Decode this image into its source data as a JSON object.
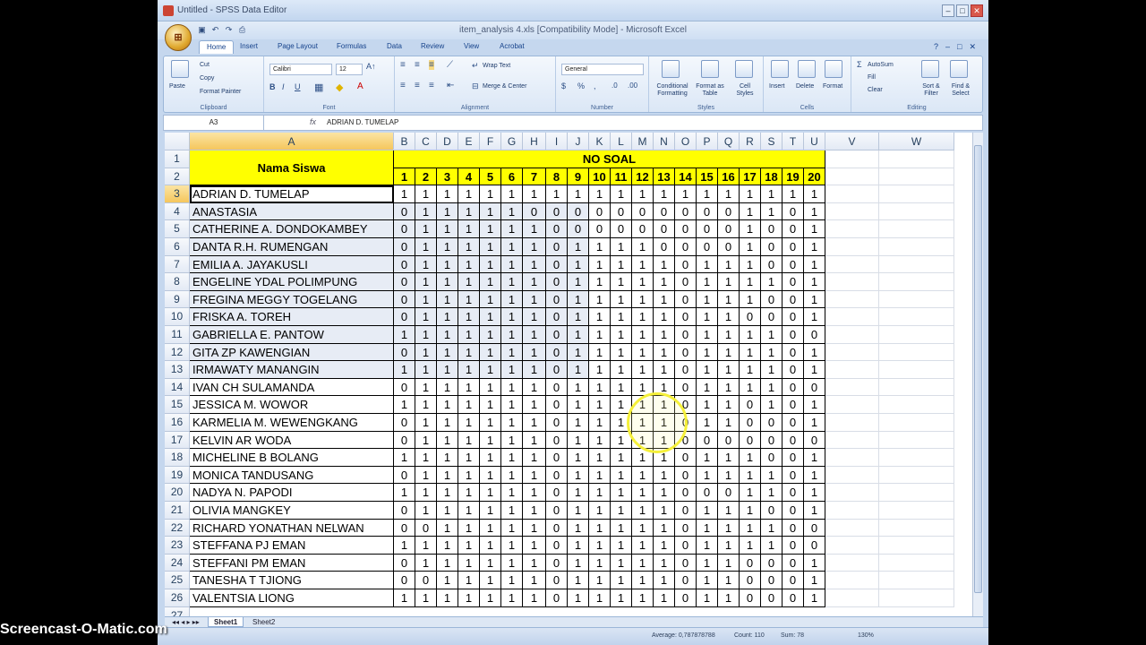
{
  "spss_title": "Untitled - SPSS Data Editor",
  "excel_title": "item_analysis 4.xls  [Compatibility Mode] - Microsoft Excel",
  "tabs": [
    "Home",
    "Insert",
    "Page Layout",
    "Formulas",
    "Data",
    "Review",
    "View",
    "Acrobat"
  ],
  "ribbon": {
    "clipboard": {
      "paste": "Paste",
      "cut": "Cut",
      "copy": "Copy",
      "format_painter": "Format Painter",
      "label": "Clipboard"
    },
    "font": {
      "name": "Calibri",
      "size": "12",
      "label": "Font"
    },
    "alignment": {
      "wrap": "Wrap Text",
      "merge": "Merge & Center",
      "label": "Alignment"
    },
    "number": {
      "format": "General",
      "label": "Number"
    },
    "styles": {
      "conditional": "Conditional Formatting",
      "format_table": "Format as Table",
      "cell_styles": "Cell Styles",
      "label": "Styles"
    },
    "cells": {
      "insert": "Insert",
      "delete": "Delete",
      "format": "Format",
      "label": "Cells"
    },
    "editing": {
      "autosum": "AutoSum",
      "fill": "Fill",
      "clear": "Clear",
      "sort": "Sort & Filter",
      "find": "Find & Select",
      "label": "Editing"
    }
  },
  "formula_bar": {
    "cell_ref": "A3",
    "fx": "fx",
    "content": "ADRIAN D. TUMELAP"
  },
  "columns": [
    "A",
    "B",
    "C",
    "D",
    "E",
    "F",
    "G",
    "H",
    "I",
    "J",
    "K",
    "L",
    "M",
    "N",
    "O",
    "P",
    "Q",
    "R",
    "S",
    "T",
    "U",
    "V",
    "W"
  ],
  "header": {
    "nama": "Nama Siswa",
    "no_soal": "NO SOAL",
    "items": [
      "1",
      "2",
      "3",
      "4",
      "5",
      "6",
      "7",
      "8",
      "9",
      "10",
      "11",
      "12",
      "13",
      "14",
      "15",
      "16",
      "17",
      "18",
      "19",
      "20"
    ]
  },
  "rows": [
    {
      "n": "3",
      "name": "ADRIAN D. TUMELAP",
      "v": "1 1 1 1 1 1 1 1 1 1 1 1 1 1 1 1 1 1 1 1"
    },
    {
      "n": "4",
      "name": "ANASTASIA",
      "v": "0 1 1 1 1 1 0 0 0 0 0 0 0 0 0 0 1 1 0 1"
    },
    {
      "n": "5",
      "name": "CATHERINE A. DONDOKAMBEY",
      "v": "0 1 1 1 1 1 1 0 0 0 0 0 0 0 0 0 1 0 0 1"
    },
    {
      "n": "6",
      "name": "DANTA R.H. RUMENGAN",
      "v": "0 1 1 1 1 1 1 0 1 1 1 1 0 0 0 0 1 0 0 1"
    },
    {
      "n": "7",
      "name": "EMILIA A. JAYAKUSLI",
      "v": "0 1 1 1 1 1 1 0 1 1 1 1 1 0 1 1 1 0 0 1"
    },
    {
      "n": "8",
      "name": "ENGELINE YDAL POLIMPUNG",
      "v": "0 1 1 1 1 1 1 0 1 1 1 1 1 0 1 1 1 1 0 1"
    },
    {
      "n": "9",
      "name": "FREGINA MEGGY TOGELANG",
      "v": "0 1 1 1 1 1 1 0 1 1 1 1 1 0 1 1 1 0 0 1"
    },
    {
      "n": "10",
      "name": "FRISKA A. TOREH",
      "v": "0 1 1 1 1 1 1 0 1 1 1 1 1 0 1 1 0 0 0 1"
    },
    {
      "n": "11",
      "name": "GABRIELLA E. PANTOW",
      "v": "1 1 1 1 1 1 1 0 1 1 1 1 1 0 1 1 1 1 0 0"
    },
    {
      "n": "12",
      "name": "GITA ZP KAWENGIAN",
      "v": "0 1 1 1 1 1 1 0 1 1 1 1 1 0 1 1 1 1 0 1"
    },
    {
      "n": "13",
      "name": "IRMAWATY MANANGIN",
      "v": "1 1 1 1 1 1 1 0 1 1 1 1 1 0 1 1 1 1 0 1"
    },
    {
      "n": "14",
      "name": "IVAN CH SULAMANDA",
      "v": "0 1 1 1 1 1 1 0 1 1 1 1 1 0 1 1 1 1 0 0"
    },
    {
      "n": "15",
      "name": "JESSICA M. WOWOR",
      "v": "1 1 1 1 1 1 1 0 1 1 1 1 1 0 1 1 0 1 0 1"
    },
    {
      "n": "16",
      "name": "KARMELIA M. WEWENGKANG",
      "v": "0 1 1 1 1 1 1 0 1 1 1 1 1 0 1 1 0 0 0 1"
    },
    {
      "n": "17",
      "name": "KELVIN AR WODA",
      "v": "0 1 1 1 1 1 1 0 1 1 1 1 1 0 0 0 0 0 0 0"
    },
    {
      "n": "18",
      "name": "MICHELINE B BOLANG",
      "v": "1 1 1 1 1 1 1 0 1 1 1 1 1 0 1 1 1 0 0 1"
    },
    {
      "n": "19",
      "name": "MONICA TANDUSANG",
      "v": "0 1 1 1 1 1 1 0 1 1 1 1 1 0 1 1 1 1 0 1"
    },
    {
      "n": "20",
      "name": "NADYA N. PAPODI",
      "v": "1 1 1 1 1 1 1 0 1 1 1 1 1 0 0 0 1 1 0 1"
    },
    {
      "n": "21",
      "name": "OLIVIA MANGKEY",
      "v": "0 1 1 1 1 1 1 0 1 1 1 1 1 0 1 1 1 0 0 1"
    },
    {
      "n": "22",
      "name": "RICHARD YONATHAN NELWAN",
      "v": "0 0 1 1 1 1 1 0 1 1 1 1 1 0 1 1 1 1 0 0"
    },
    {
      "n": "23",
      "name": "STEFFANA PJ EMAN",
      "v": "1 1 1 1 1 1 1 0 1 1 1 1 1 0 1 1 1 1 0 0"
    },
    {
      "n": "24",
      "name": "STEFFANI PM EMAN",
      "v": "0 1 1 1 1 1 1 0 1 1 1 1 1 0 1 1 0 0 0 1"
    },
    {
      "n": "25",
      "name": "TANESHA T TJIONG",
      "v": "0 0 1 1 1 1 1 0 1 1 1 1 1 0 1 1 0 0 0 1"
    },
    {
      "n": "26",
      "name": "VALENTSIA LIONG",
      "v": "1 1 1 1 1 1 1 0 1 1 1 1 1 0 1 1 0 0 0 1"
    }
  ],
  "sheets": [
    "Sheet1",
    "Sheet2"
  ],
  "status": {
    "average": "Average: 0,787878788",
    "count": "Count: 110",
    "sum": "Sum: 78",
    "zoom": "130%"
  },
  "watermark": "Screencast-O-Matic.com"
}
